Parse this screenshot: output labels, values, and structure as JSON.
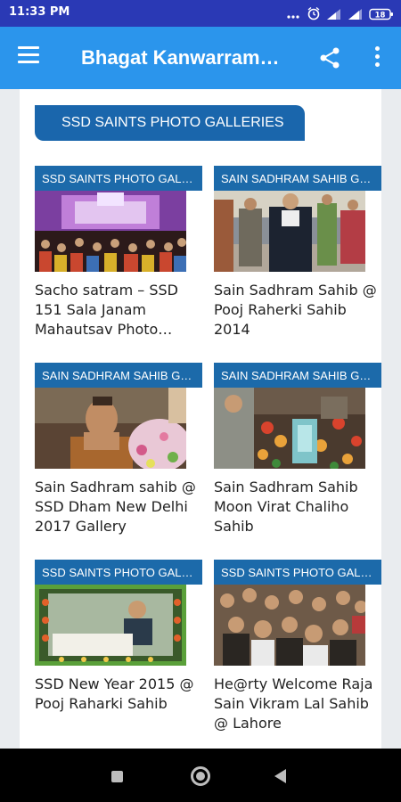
{
  "status_bar": {
    "time": "11:33 PM",
    "icons": [
      "dots-icon",
      "alarm-icon",
      "signal-icon",
      "signal-icon",
      "battery-icon"
    ],
    "battery": "18"
  },
  "app_bar": {
    "title": "Bhagat Kanwarram…",
    "color": "#2b95ec"
  },
  "section": {
    "title": "SSD SAINTS PHOTO GALLERIES"
  },
  "cards": [
    {
      "badge": "SSD SAINTS PHOTO GAL…",
      "title": "Sacho satram – SSD 151 Sala Janam Mahautsav Photo…"
    },
    {
      "badge": "SAIN SADHRAM SAHIB G…",
      "title": "Sain Sadhram Sahib @ Pooj Raherki Sahib 2014"
    },
    {
      "badge": "SAIN SADHRAM SAHIB G…",
      "title": "Sain Sadhram sahib @ SSD Dham New Delhi 2017 Gallery"
    },
    {
      "badge": "SAIN SADHRAM SAHIB G…",
      "title": "Sain Sadhram Sahib Moon Virat Chaliho Sahib"
    },
    {
      "badge": "SSD SAINTS PHOTO GAL…",
      "title": "SSD New Year 2015 @ Pooj Raharki Sahib"
    },
    {
      "badge": "SSD SAINTS PHOTO GAL…",
      "title": "He@rty Welcome Raja Sain Vikram Lal Sahib @ Lahore"
    }
  ],
  "colors": {
    "status_bar": "#2a39b5",
    "badge": "#1c6aaa",
    "section_header": "#1a66ac"
  }
}
